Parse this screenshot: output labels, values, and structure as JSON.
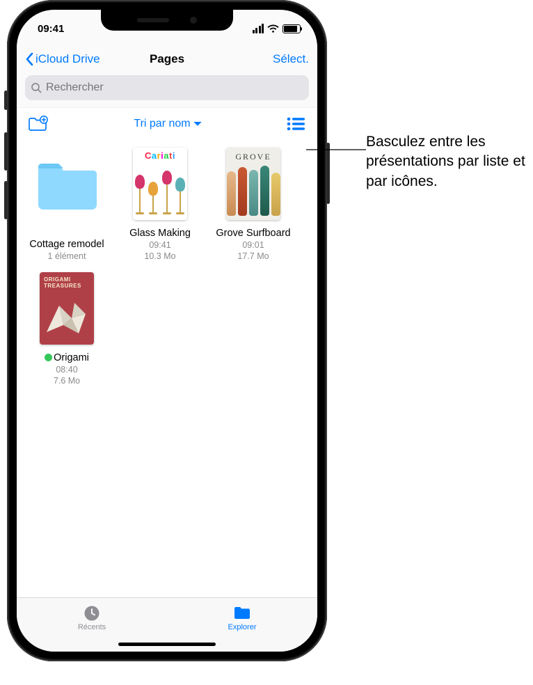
{
  "statusbar": {
    "time": "09:41"
  },
  "nav": {
    "back": "iCloud Drive",
    "title": "Pages",
    "select": "Sélect."
  },
  "search": {
    "placeholder": "Rechercher"
  },
  "toolbar": {
    "sort_label": "Tri par nom"
  },
  "items": [
    {
      "kind": "folder",
      "name": "Cottage remodel",
      "meta1": "1 élément",
      "meta2": ""
    },
    {
      "kind": "doc",
      "art": "cariati",
      "name": "Glass Making",
      "meta1": "09:41",
      "meta2": "10.3 Mo"
    },
    {
      "kind": "doc",
      "art": "grove",
      "name": "Grove Surfboard",
      "meta1": "09:01",
      "meta2": "17.7 Mo"
    },
    {
      "kind": "doc",
      "art": "origami",
      "name": "Origami",
      "meta1": "08:40",
      "meta2": "7.6 Mo",
      "tag": "#34c759"
    }
  ],
  "thumb_text": {
    "cariati": "Cariati",
    "grove": "GROVE",
    "origami_l1": "ORIGAMI",
    "origami_l2": "TREASURES"
  },
  "tabs": {
    "recents": "Récents",
    "browse": "Explorer"
  },
  "callout": {
    "text": "Basculez entre les présentations par liste et par icônes."
  }
}
